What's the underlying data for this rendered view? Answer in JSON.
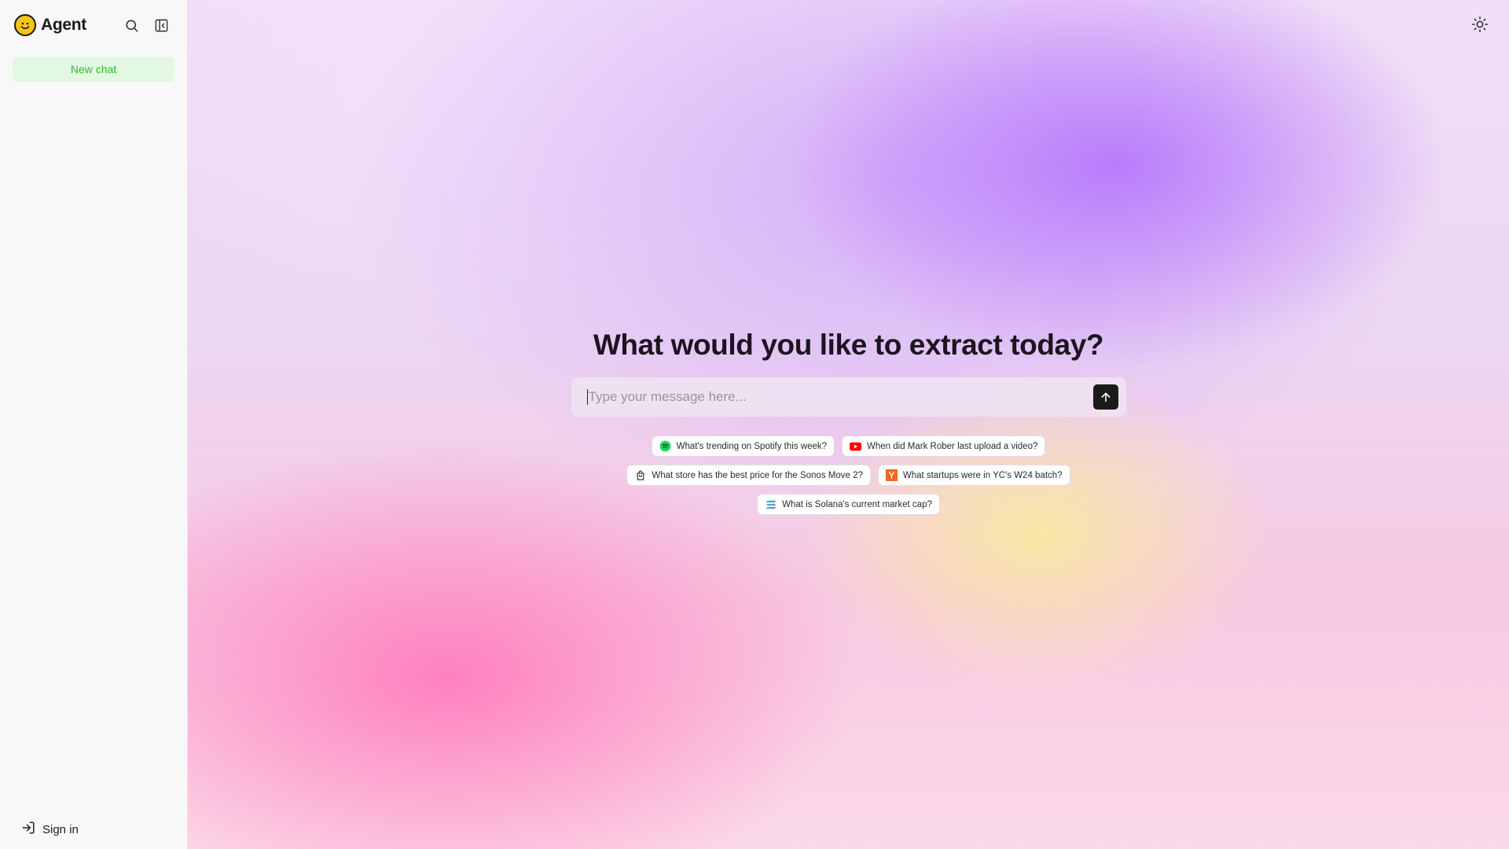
{
  "sidebar": {
    "brand_name": "Agent",
    "new_chat_label": "New chat",
    "signin_label": "Sign in",
    "accent_color": "#2bc02b"
  },
  "main": {
    "headline": "What would you like to extract today?",
    "composer": {
      "placeholder": "Type your message here..."
    },
    "suggestions": [
      {
        "label": "What's trending on Spotify this week?",
        "icon": "spotify-icon"
      },
      {
        "label": "When did Mark Rober last upload a video?",
        "icon": "youtube-icon"
      },
      {
        "label": "What store has the best price for the Sonos Move 2?",
        "icon": "shopping-bag-icon"
      },
      {
        "label": "What startups were in YC's W24 batch?",
        "icon": "ycombinator-icon"
      },
      {
        "label": "What is Solana's current market cap?",
        "icon": "solana-icon"
      }
    ]
  },
  "colors": {
    "spotify": "#1ed760",
    "youtube": "#ff0000",
    "ycombinator": "#f26522"
  }
}
